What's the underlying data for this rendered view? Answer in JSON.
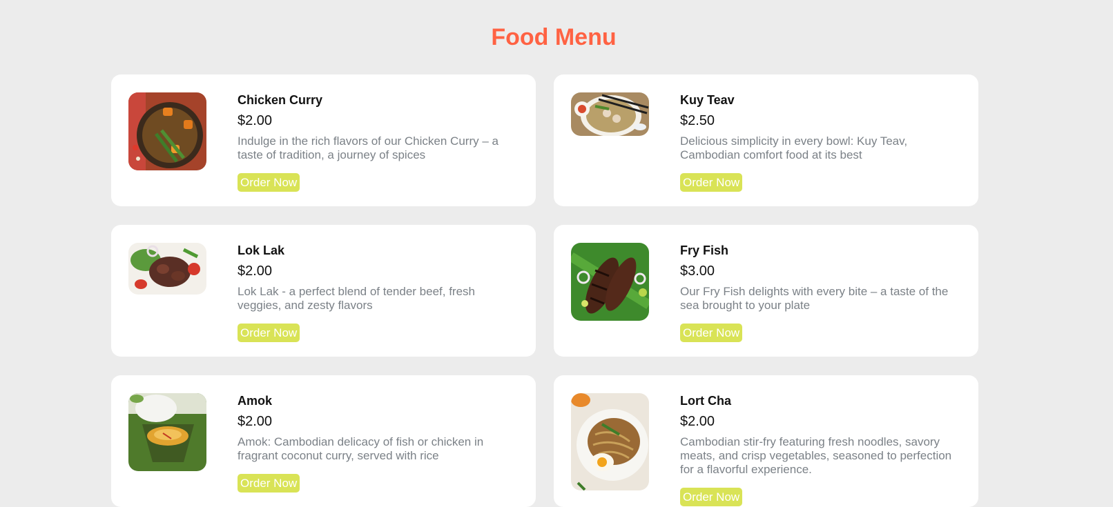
{
  "page": {
    "title": "Food Menu"
  },
  "theme": {
    "title_color": "#ff6243",
    "button_color": "#d9e356",
    "background": "#ececec",
    "card_background": "#ffffff"
  },
  "items": [
    {
      "name": "Chicken Curry",
      "price": "$2.00",
      "description": "Indulge in the rich flavors of our Chicken Curry – a taste of tradition, a journey of spices",
      "button": "Order Now",
      "image": "chicken-curry-photo"
    },
    {
      "name": "Kuy Teav",
      "price": "$2.50",
      "description": "Delicious simplicity in every bowl: Kuy Teav, Cambodian comfort food at its best",
      "button": "Order Now",
      "image": "kuy-teav-photo"
    },
    {
      "name": "Lok Lak",
      "price": "$2.00",
      "description": "Lok Lak - a perfect blend of tender beef, fresh veggies, and zesty flavors",
      "button": "Order Now",
      "image": "lok-lak-photo"
    },
    {
      "name": "Fry Fish",
      "price": "$3.00",
      "description": "Our Fry Fish delights with every bite – a taste of the sea brought to your plate",
      "button": "Order Now",
      "image": "fry-fish-photo"
    },
    {
      "name": "Amok",
      "price": "$2.00",
      "description": "Amok: Cambodian delicacy of fish or chicken in fragrant coconut curry, served with rice",
      "button": "Order Now",
      "image": "amok-photo"
    },
    {
      "name": "Lort Cha",
      "price": "$2.00",
      "description": "Cambodian stir-fry featuring fresh noodles, savory meats, and crisp vegetables, seasoned to perfection for a flavorful experience.",
      "button": "Order Now",
      "image": "lort-cha-photo"
    }
  ]
}
